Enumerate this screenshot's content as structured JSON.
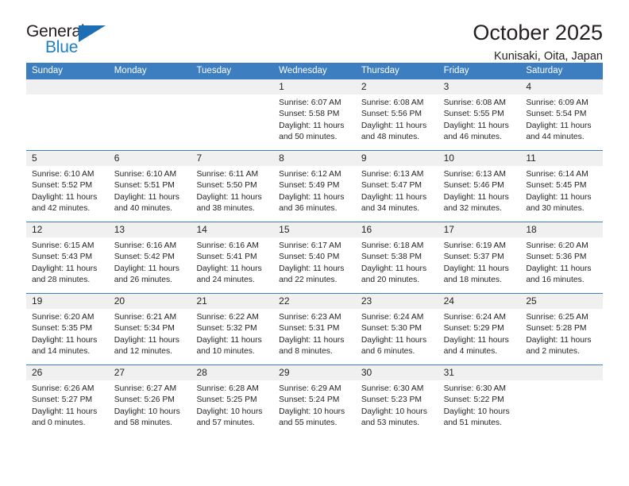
{
  "brand": {
    "name_part1": "General",
    "name_part2": "Blue",
    "triangle_color": "#1d6fb5",
    "blue_color": "#1f7fc4"
  },
  "header": {
    "title": "October 2025",
    "subtitle": "Kunisaki, Oita, Japan"
  },
  "theme": {
    "header_blue": "#3c7ebf",
    "day_number_bg": "#f0f0f0",
    "text_color": "#231f20"
  },
  "weekdays": [
    "Sunday",
    "Monday",
    "Tuesday",
    "Wednesday",
    "Thursday",
    "Friday",
    "Saturday"
  ],
  "weeks": [
    [
      {
        "day": "",
        "empty": true
      },
      {
        "day": "",
        "empty": true
      },
      {
        "day": "",
        "empty": true
      },
      {
        "day": "1",
        "sunrise": "Sunrise: 6:07 AM",
        "sunset": "Sunset: 5:58 PM",
        "daylight": "Daylight: 11 hours and 50 minutes."
      },
      {
        "day": "2",
        "sunrise": "Sunrise: 6:08 AM",
        "sunset": "Sunset: 5:56 PM",
        "daylight": "Daylight: 11 hours and 48 minutes."
      },
      {
        "day": "3",
        "sunrise": "Sunrise: 6:08 AM",
        "sunset": "Sunset: 5:55 PM",
        "daylight": "Daylight: 11 hours and 46 minutes."
      },
      {
        "day": "4",
        "sunrise": "Sunrise: 6:09 AM",
        "sunset": "Sunset: 5:54 PM",
        "daylight": "Daylight: 11 hours and 44 minutes."
      }
    ],
    [
      {
        "day": "5",
        "sunrise": "Sunrise: 6:10 AM",
        "sunset": "Sunset: 5:52 PM",
        "daylight": "Daylight: 11 hours and 42 minutes."
      },
      {
        "day": "6",
        "sunrise": "Sunrise: 6:10 AM",
        "sunset": "Sunset: 5:51 PM",
        "daylight": "Daylight: 11 hours and 40 minutes."
      },
      {
        "day": "7",
        "sunrise": "Sunrise: 6:11 AM",
        "sunset": "Sunset: 5:50 PM",
        "daylight": "Daylight: 11 hours and 38 minutes."
      },
      {
        "day": "8",
        "sunrise": "Sunrise: 6:12 AM",
        "sunset": "Sunset: 5:49 PM",
        "daylight": "Daylight: 11 hours and 36 minutes."
      },
      {
        "day": "9",
        "sunrise": "Sunrise: 6:13 AM",
        "sunset": "Sunset: 5:47 PM",
        "daylight": "Daylight: 11 hours and 34 minutes."
      },
      {
        "day": "10",
        "sunrise": "Sunrise: 6:13 AM",
        "sunset": "Sunset: 5:46 PM",
        "daylight": "Daylight: 11 hours and 32 minutes."
      },
      {
        "day": "11",
        "sunrise": "Sunrise: 6:14 AM",
        "sunset": "Sunset: 5:45 PM",
        "daylight": "Daylight: 11 hours and 30 minutes."
      }
    ],
    [
      {
        "day": "12",
        "sunrise": "Sunrise: 6:15 AM",
        "sunset": "Sunset: 5:43 PM",
        "daylight": "Daylight: 11 hours and 28 minutes."
      },
      {
        "day": "13",
        "sunrise": "Sunrise: 6:16 AM",
        "sunset": "Sunset: 5:42 PM",
        "daylight": "Daylight: 11 hours and 26 minutes."
      },
      {
        "day": "14",
        "sunrise": "Sunrise: 6:16 AM",
        "sunset": "Sunset: 5:41 PM",
        "daylight": "Daylight: 11 hours and 24 minutes."
      },
      {
        "day": "15",
        "sunrise": "Sunrise: 6:17 AM",
        "sunset": "Sunset: 5:40 PM",
        "daylight": "Daylight: 11 hours and 22 minutes."
      },
      {
        "day": "16",
        "sunrise": "Sunrise: 6:18 AM",
        "sunset": "Sunset: 5:38 PM",
        "daylight": "Daylight: 11 hours and 20 minutes."
      },
      {
        "day": "17",
        "sunrise": "Sunrise: 6:19 AM",
        "sunset": "Sunset: 5:37 PM",
        "daylight": "Daylight: 11 hours and 18 minutes."
      },
      {
        "day": "18",
        "sunrise": "Sunrise: 6:20 AM",
        "sunset": "Sunset: 5:36 PM",
        "daylight": "Daylight: 11 hours and 16 minutes."
      }
    ],
    [
      {
        "day": "19",
        "sunrise": "Sunrise: 6:20 AM",
        "sunset": "Sunset: 5:35 PM",
        "daylight": "Daylight: 11 hours and 14 minutes."
      },
      {
        "day": "20",
        "sunrise": "Sunrise: 6:21 AM",
        "sunset": "Sunset: 5:34 PM",
        "daylight": "Daylight: 11 hours and 12 minutes."
      },
      {
        "day": "21",
        "sunrise": "Sunrise: 6:22 AM",
        "sunset": "Sunset: 5:32 PM",
        "daylight": "Daylight: 11 hours and 10 minutes."
      },
      {
        "day": "22",
        "sunrise": "Sunrise: 6:23 AM",
        "sunset": "Sunset: 5:31 PM",
        "daylight": "Daylight: 11 hours and 8 minutes."
      },
      {
        "day": "23",
        "sunrise": "Sunrise: 6:24 AM",
        "sunset": "Sunset: 5:30 PM",
        "daylight": "Daylight: 11 hours and 6 minutes."
      },
      {
        "day": "24",
        "sunrise": "Sunrise: 6:24 AM",
        "sunset": "Sunset: 5:29 PM",
        "daylight": "Daylight: 11 hours and 4 minutes."
      },
      {
        "day": "25",
        "sunrise": "Sunrise: 6:25 AM",
        "sunset": "Sunset: 5:28 PM",
        "daylight": "Daylight: 11 hours and 2 minutes."
      }
    ],
    [
      {
        "day": "26",
        "sunrise": "Sunrise: 6:26 AM",
        "sunset": "Sunset: 5:27 PM",
        "daylight": "Daylight: 11 hours and 0 minutes."
      },
      {
        "day": "27",
        "sunrise": "Sunrise: 6:27 AM",
        "sunset": "Sunset: 5:26 PM",
        "daylight": "Daylight: 10 hours and 58 minutes."
      },
      {
        "day": "28",
        "sunrise": "Sunrise: 6:28 AM",
        "sunset": "Sunset: 5:25 PM",
        "daylight": "Daylight: 10 hours and 57 minutes."
      },
      {
        "day": "29",
        "sunrise": "Sunrise: 6:29 AM",
        "sunset": "Sunset: 5:24 PM",
        "daylight": "Daylight: 10 hours and 55 minutes."
      },
      {
        "day": "30",
        "sunrise": "Sunrise: 6:30 AM",
        "sunset": "Sunset: 5:23 PM",
        "daylight": "Daylight: 10 hours and 53 minutes."
      },
      {
        "day": "31",
        "sunrise": "Sunrise: 6:30 AM",
        "sunset": "Sunset: 5:22 PM",
        "daylight": "Daylight: 10 hours and 51 minutes."
      },
      {
        "day": "",
        "empty": true
      }
    ]
  ]
}
